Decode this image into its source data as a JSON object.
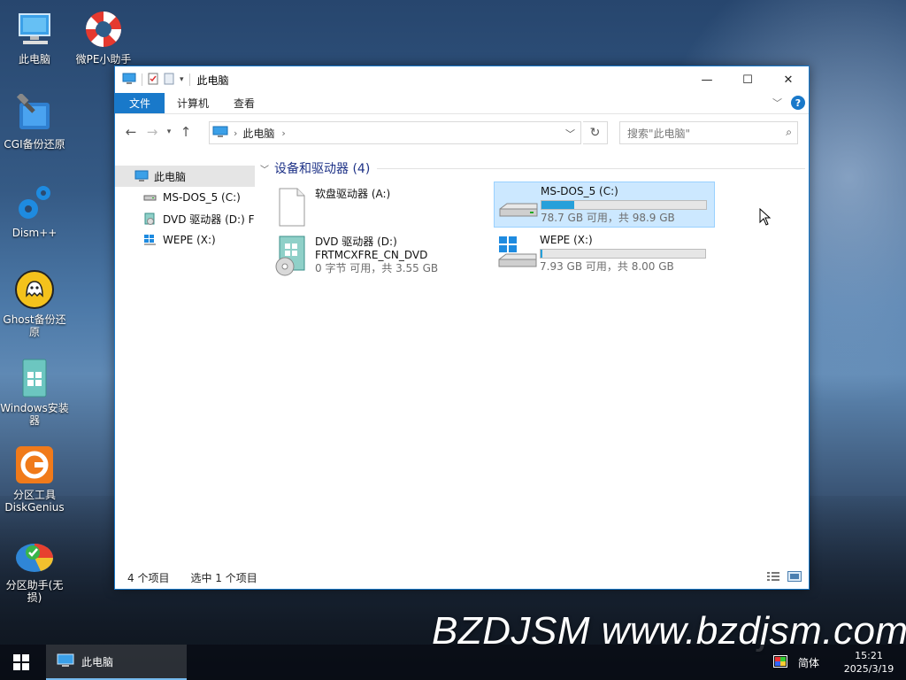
{
  "desktop": {
    "icons": [
      {
        "label": "此电脑"
      },
      {
        "label": "微PE小助手"
      },
      {
        "label": "CGI备份还原"
      },
      {
        "label": "Dism++"
      },
      {
        "label": "Ghost备份还原"
      },
      {
        "label": "Windows安装器"
      },
      {
        "label": "分区工具DiskGenius"
      },
      {
        "label": "分区助手(无损)"
      }
    ]
  },
  "window": {
    "title": "此电脑",
    "ribbon_tabs": [
      "文件",
      "计算机",
      "查看"
    ],
    "address_crumb": "此电脑",
    "search_placeholder": "搜索\"此电脑\"",
    "nav_tree": [
      {
        "label": "此电脑"
      },
      {
        "label": "MS-DOS_5 (C:)"
      },
      {
        "label": "DVD 驱动器 (D:) FR"
      },
      {
        "label": "WEPE (X:)"
      }
    ],
    "group_title": "设备和驱动器 (4)",
    "drives": [
      {
        "name": "软盘驱动器 (A:)",
        "line2": "",
        "usage": ""
      },
      {
        "name": "MS-DOS_5 (C:)",
        "usage": "78.7 GB 可用，共 98.9 GB",
        "used_fraction": 0.2
      },
      {
        "name": "DVD 驱动器 (D:)",
        "line2": "FRTMCXFRE_CN_DVD",
        "usage": "0 字节 可用，共 3.55 GB"
      },
      {
        "name": "WEPE (X:)",
        "usage": "7.93 GB 可用，共 8.00 GB",
        "used_fraction": 0.009
      }
    ],
    "status": {
      "count": "4 个项目",
      "selected": "选中 1 个项目"
    }
  },
  "watermark": "BZDJSM www.bzdjsm.com",
  "taskbar": {
    "active_item": "此电脑",
    "ime": "简体",
    "time": "15:21",
    "date": "2025/3/19"
  },
  "colors": {
    "accent": "#1979ca",
    "selection": "#cce8ff",
    "bar_fill": "#26a0da"
  }
}
